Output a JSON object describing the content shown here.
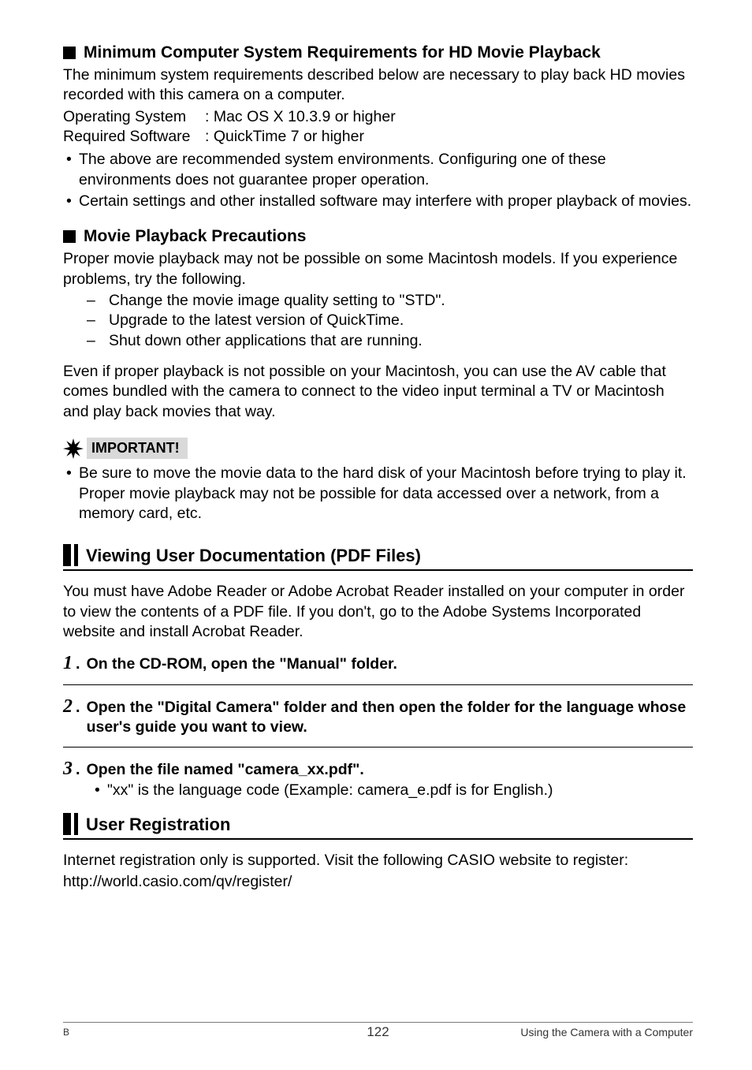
{
  "sections": {
    "s1": {
      "heading": "Minimum Computer System Requirements for HD Movie Playback",
      "intro": "The minimum system requirements described below are necessary to play back HD movies recorded with this camera on a computer.",
      "os_label": "Operating System",
      "os_value": ": Mac OS X 10.3.9 or higher",
      "sw_label": "Required Software",
      "sw_value": ": QuickTime 7 or higher",
      "bullets": [
        "The above are recommended system environments. Configuring one of these environments does not guarantee proper operation.",
        "Certain settings and other installed software may interfere with proper playback of movies."
      ]
    },
    "s2": {
      "heading": "Movie Playback Precautions",
      "intro": "Proper movie playback may not be possible on some Macintosh models. If you experience problems, try the following.",
      "dashes": [
        "Change the movie image quality setting to \"STD\".",
        "Upgrade to the latest version of QuickTime.",
        "Shut down other applications that are running."
      ],
      "para2": "Even if proper playback is not possible on your Macintosh, you can use the AV cable that comes bundled with the camera to connect to the video input terminal a TV or Macintosh and play back movies that way."
    },
    "important": {
      "label": "IMPORTANT!",
      "bullets": [
        "Be sure to move the movie data to the hard disk of your Macintosh before trying to play it. Proper movie playback may not be possible for data accessed over a network, from a memory card, etc."
      ]
    },
    "docs": {
      "heading": "Viewing User Documentation (PDF Files)",
      "intro": "You must have Adobe Reader or Adobe Acrobat Reader installed on your computer in order to view the contents of a PDF file. If you don't, go to the Adobe Systems Incorporated website and install Acrobat Reader.",
      "steps": [
        "On the CD-ROM, open the \"Manual\" folder.",
        "Open the \"Digital Camera\" folder and then open the folder for the language whose user's guide you want to view.",
        "Open the file named \"camera_xx.pdf\"."
      ],
      "step3_note": "\"xx\" is the language code (Example: camera_e.pdf is for English.)"
    },
    "reg": {
      "heading": "User Registration",
      "text": "Internet registration only is supported. Visit the following CASIO website to register:",
      "url": "http://world.casio.com/qv/register/"
    }
  },
  "footer": {
    "left": "B",
    "center": "122",
    "right": "Using the Camera with a Computer"
  }
}
